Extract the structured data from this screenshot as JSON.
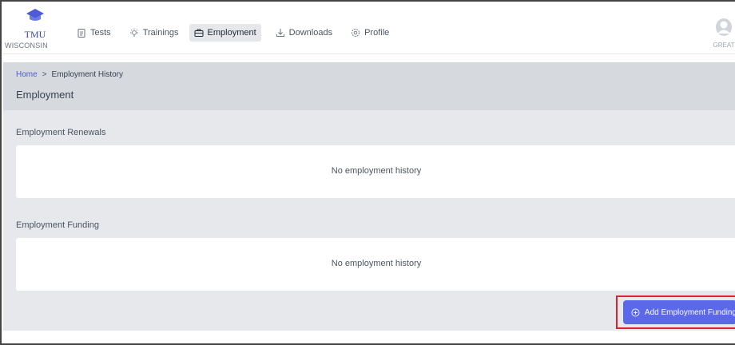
{
  "brand": {
    "name": "TMU",
    "subtitle": "WISCONSIN"
  },
  "nav": {
    "items": [
      {
        "label": "Tests",
        "icon": "clipboard-icon",
        "active": false
      },
      {
        "label": "Trainings",
        "icon": "bulb-icon",
        "active": false
      },
      {
        "label": "Employment",
        "icon": "briefcase-icon",
        "active": true
      },
      {
        "label": "Downloads",
        "icon": "download-icon",
        "active": false
      },
      {
        "label": "Profile",
        "icon": "gear-icon",
        "active": false
      }
    ]
  },
  "user": {
    "name": "GREAT"
  },
  "breadcrumb": {
    "home": "Home",
    "separator": ">",
    "current": "Employment History"
  },
  "page": {
    "title": "Employment"
  },
  "sections": [
    {
      "title": "Employment Renewals",
      "empty_text": "No employment history"
    },
    {
      "title": "Employment Funding",
      "empty_text": "No employment history"
    }
  ],
  "actions": {
    "add_funding_label": "Add Employment Funding"
  },
  "colors": {
    "accent": "#5b68e8",
    "link": "#4f5bd5",
    "highlight_border": "#d9232e"
  }
}
